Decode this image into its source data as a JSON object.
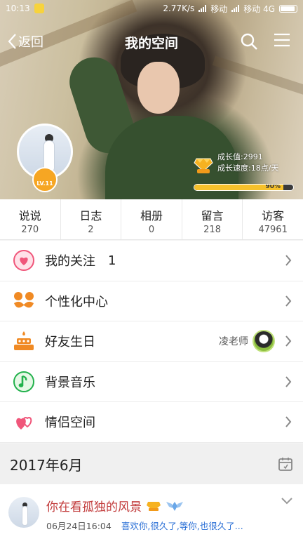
{
  "statusbar": {
    "time": "10:13",
    "speed": "2.77K/s",
    "carrier1": "移动",
    "carrier2": "移动 4G"
  },
  "navbar": {
    "back_label": "返回",
    "title": "我的空间",
    "icons": [
      "search-icon",
      "menu-icon"
    ]
  },
  "profile": {
    "level_badge": "LV.11",
    "growth_value_label": "成长值:",
    "growth_value": "2991",
    "growth_speed_label": "成长速度:",
    "growth_speed": "18点/天",
    "progress_percent": 90,
    "progress_label": "90%"
  },
  "stats": [
    {
      "label": "说说",
      "value": "270"
    },
    {
      "label": "日志",
      "value": "2"
    },
    {
      "label": "相册",
      "value": "0"
    },
    {
      "label": "留言",
      "value": "218"
    },
    {
      "label": "访客",
      "value": "47961"
    }
  ],
  "menu": {
    "follow": {
      "label": "我的关注",
      "count": "1",
      "icon": "heart-icon"
    },
    "personalize": {
      "label": "个性化中心",
      "icon": "mustache-icon"
    },
    "birthday": {
      "label": "好友生日",
      "friend": "凌老师",
      "icon": "cake-icon"
    },
    "music": {
      "label": "背景音乐",
      "icon": "music-note-icon"
    },
    "couple": {
      "label": "情侣空间",
      "icon": "double-heart-icon"
    }
  },
  "date_header": {
    "label": "2017年6月",
    "icon": "calendar-icon"
  },
  "feed": {
    "title": "你在看孤独的风景",
    "time": "06月24日16:04",
    "message": "喜欢你,很久了,等你,也很久了..."
  },
  "colors": {
    "accent_orange": "#f6a623",
    "progress_yellow": "#f6c12b",
    "feed_title_red": "#c23b3b",
    "feed_link_blue": "#2a6fd6"
  }
}
